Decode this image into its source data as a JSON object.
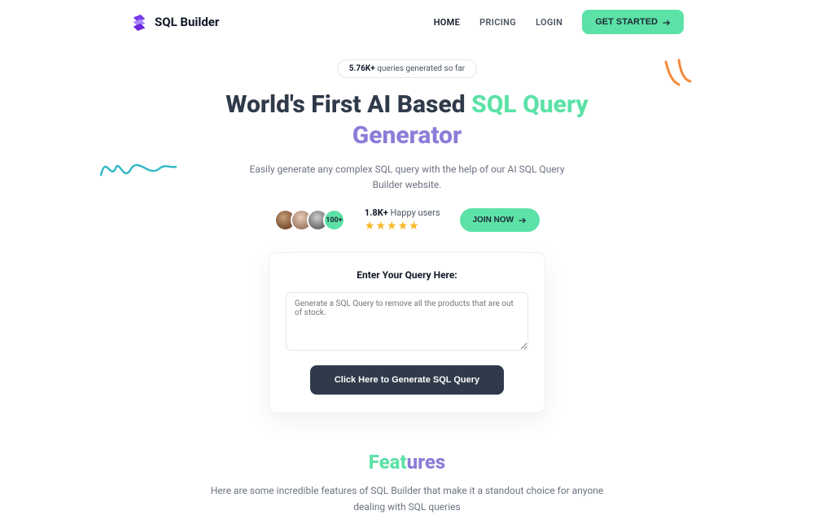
{
  "brand": {
    "name": "SQL Builder"
  },
  "nav": {
    "items": [
      {
        "label": "HOME",
        "active": true
      },
      {
        "label": "PRICING",
        "active": false
      },
      {
        "label": "LOGIN",
        "active": false
      }
    ],
    "cta_label": "GET STARTED"
  },
  "hero": {
    "pill_count": "5.76K+",
    "pill_rest": " queries generated so far",
    "headline_part1": "World's First AI Based ",
    "headline_part2": "SQL Query",
    "headline_part3": "Generator",
    "subhead_line1": "Easily generate any complex SQL query with the help of our AI SQL Query",
    "subhead_line2": "Builder website.",
    "avatars_more": "100+",
    "happy_count": "1.8K+",
    "happy_rest": " Happy users",
    "stars": "★★★★★",
    "join_label": "JOIN NOW"
  },
  "card": {
    "title": "Enter Your Query Here:",
    "placeholder": "Generate a SQL Query to remove all the products that are out of stock.",
    "button_label": "Click Here to Generate SQL Query"
  },
  "features": {
    "title_part1": "Feat",
    "title_part2": "ures",
    "sub_line1": "Here are some incredible features of SQL Builder that make it a standout choice for anyone",
    "sub_line2": "dealing with SQL queries"
  }
}
